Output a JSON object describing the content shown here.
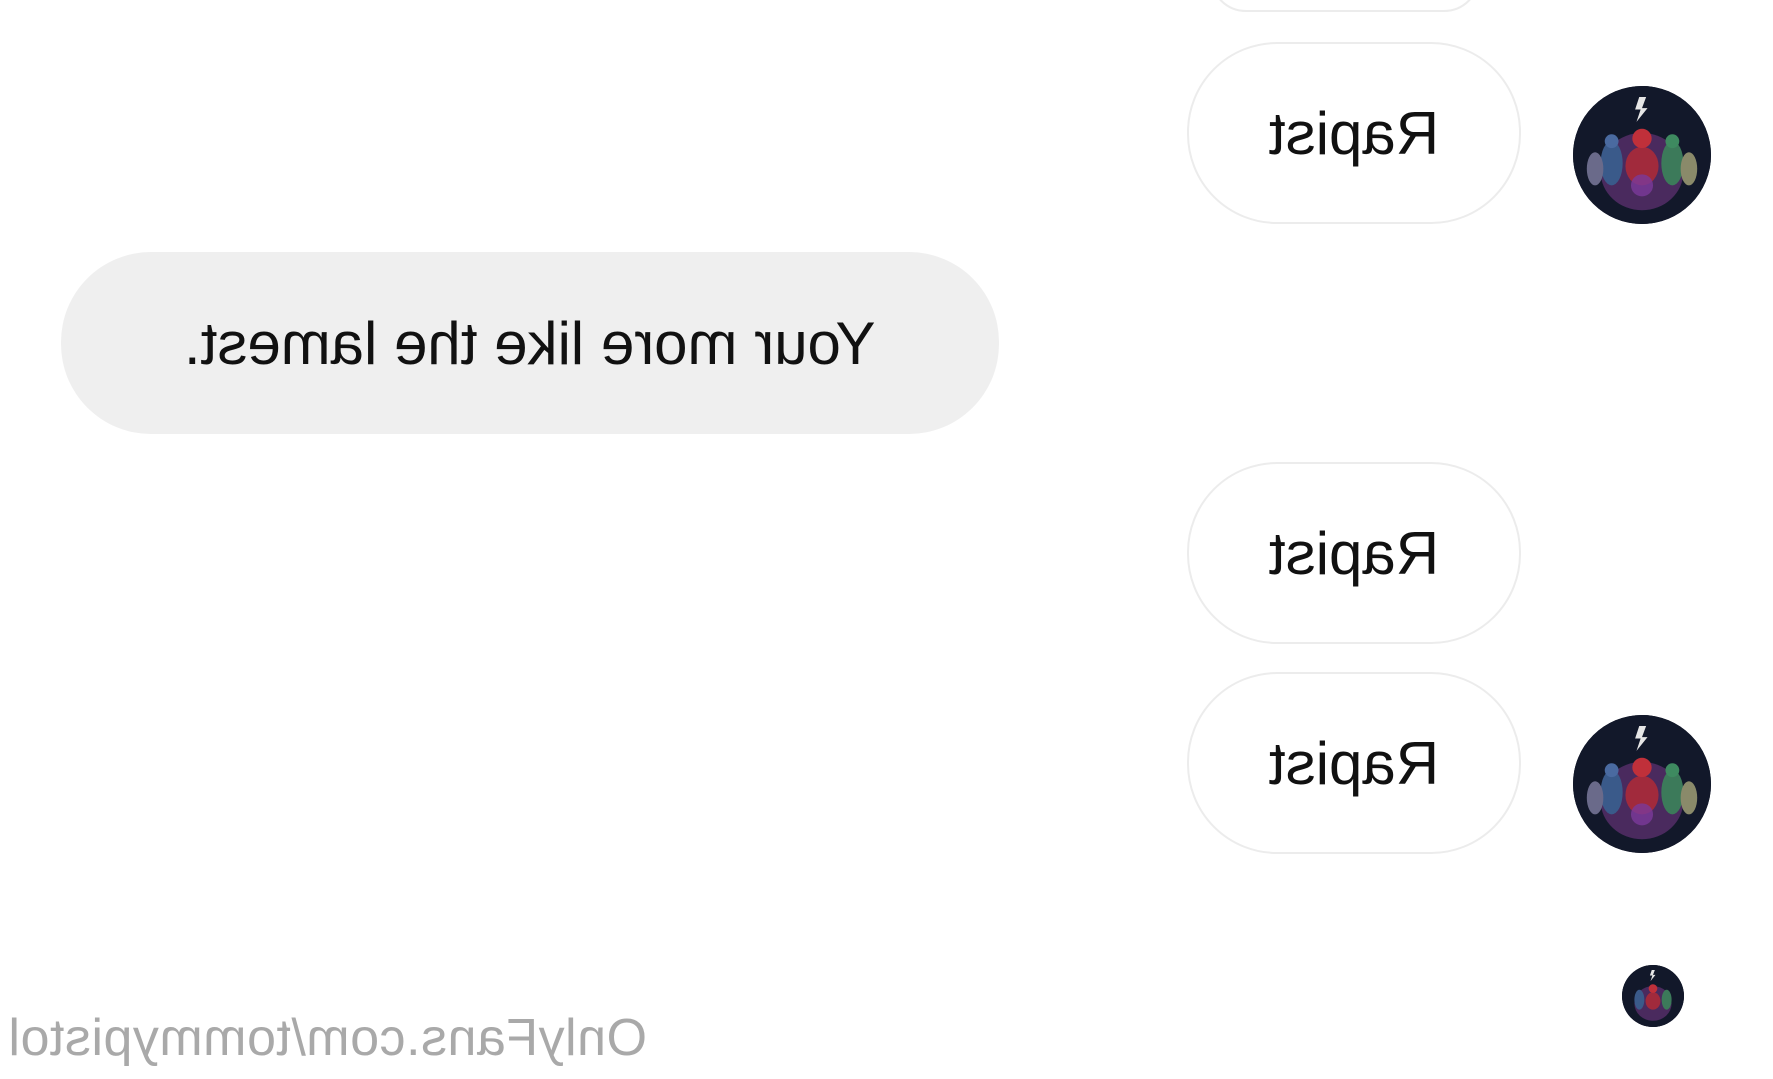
{
  "conversation": {
    "messages": [
      {
        "text": "Rapist"
      },
      {
        "text": "Your more like the lamest."
      },
      {
        "text": "Rapist"
      },
      {
        "text": "Rapist"
      }
    ]
  },
  "avatar": {
    "icon": "profile-avatar-icon"
  },
  "watermark": {
    "text": "OnlyFans.com/tommypistol"
  },
  "colors": {
    "outgoing_bubble_bg": "#ffffff",
    "outgoing_bubble_border": "#ececec",
    "incoming_bubble_bg": "#efefef",
    "text": "#111111",
    "watermark": "#a9a9a9"
  }
}
